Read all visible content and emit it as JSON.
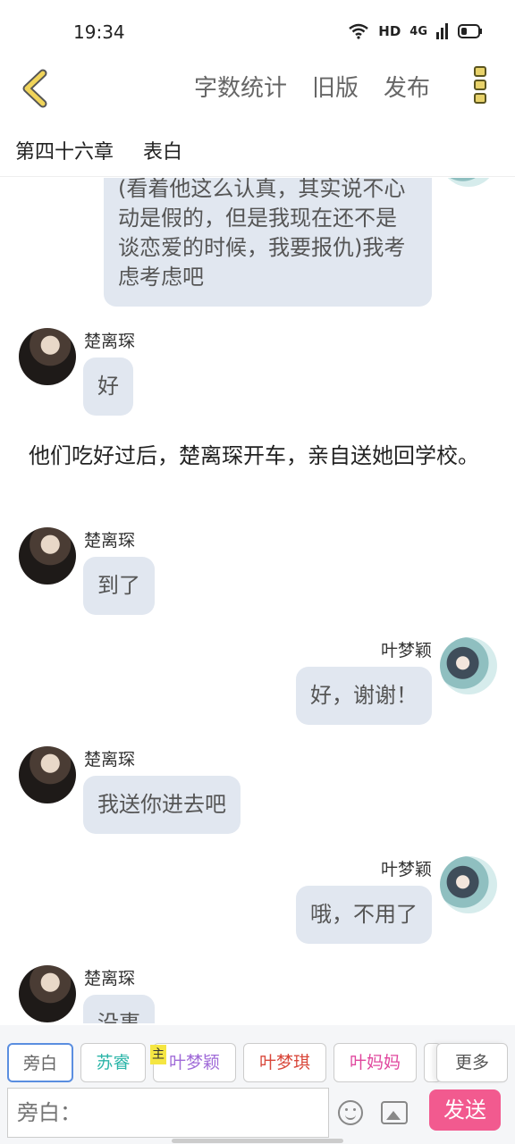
{
  "status": {
    "time": "19:34",
    "hd": "HD",
    "network": "4G"
  },
  "nav": {
    "word_count": "字数统计",
    "old_version": "旧版",
    "publish": "发布"
  },
  "chapter": {
    "number": "第四十六章",
    "title": "表白"
  },
  "messages": {
    "m0": {
      "text": "(看着他这么认真，其实说不心动是假的，但是我现在还不是谈恋爱的时候，我要报仇)我考虑考虑吧"
    },
    "m1": {
      "name": "楚离琛",
      "text": "好"
    },
    "narration": "他们吃好过后，楚离琛开车，亲自送她回学校。",
    "m2": {
      "name": "楚离琛",
      "text": "到了"
    },
    "m3": {
      "name": "叶梦颖",
      "text": "好，谢谢！"
    },
    "m4": {
      "name": "楚离琛",
      "text": "我送你进去吧"
    },
    "m5": {
      "name": "叶梦颖",
      "text": "哦，不用了"
    },
    "m6": {
      "name": "楚离琛",
      "text": "没事"
    }
  },
  "roles": {
    "narrator": "旁白",
    "surui": "苏睿",
    "main_tag": "主",
    "ye_mengying": "叶梦颖",
    "ye_mengqi": "叶梦琪",
    "ye_mama": "叶妈妈",
    "more": "更多",
    "colors": {
      "narrator": "#666666",
      "surui": "#2bb5a8",
      "ye_mengying": "#a06bd8",
      "ye_mengqi": "#d9483b",
      "ye_mama": "#e0479e",
      "active_border": "#5a8ee0"
    }
  },
  "input": {
    "placeholder": "旁白：",
    "send": "发送"
  }
}
